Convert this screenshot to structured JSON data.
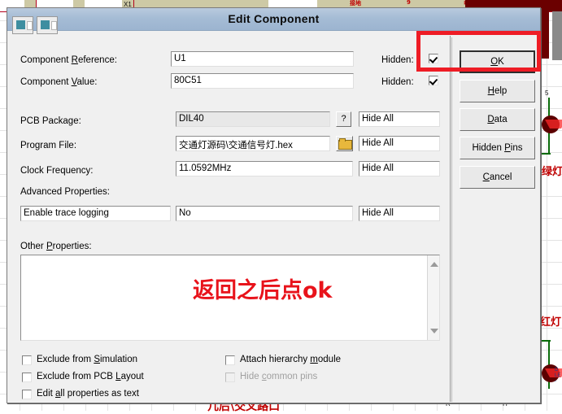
{
  "window": {
    "title": "Edit Component",
    "icons": [
      "document-icon-1",
      "document-icon-2"
    ]
  },
  "form": {
    "component_reference": {
      "label": "Component Reference:",
      "value": "U1",
      "hidden_label": "Hidden:",
      "hidden_checked": true
    },
    "component_value": {
      "label": "Component Value:",
      "value": "80C51",
      "hidden_label": "Hidden:",
      "hidden_checked": true
    },
    "pcb_package": {
      "label": "PCB Package:",
      "value": "DIL40",
      "help_button": "?",
      "visibility": "Hide All"
    },
    "program_file": {
      "label": "Program File:",
      "value": "交通灯源码\\交通信号灯.hex",
      "browse_icon": "folder-open-icon",
      "visibility": "Hide All"
    },
    "clock_frequency": {
      "label": "Clock Frequency:",
      "value": "11.0592MHz",
      "visibility": "Hide All"
    },
    "advanced_properties": {
      "label": "Advanced Properties:",
      "property": "Enable trace logging",
      "value": "No",
      "visibility": "Hide All"
    },
    "other_properties": {
      "label": "Other Properties:",
      "value": "",
      "annotation": "返回之后点ok"
    },
    "checkboxes": [
      {
        "label": "Exclude from Simulation",
        "checked": false,
        "disabled": false
      },
      {
        "label": "Exclude from PCB Layout",
        "checked": false,
        "disabled": false
      },
      {
        "label": "Edit all properties as text",
        "checked": false,
        "disabled": false
      },
      {
        "label": "Attach hierarchy module",
        "checked": false,
        "disabled": false
      },
      {
        "label": "Hide common pins",
        "checked": false,
        "disabled": true
      }
    ]
  },
  "buttons": [
    {
      "label": "OK",
      "default": true
    },
    {
      "label": "Help",
      "default": false
    },
    {
      "label": "Data",
      "default": false
    },
    {
      "label": "Hidden Pins",
      "default": false
    },
    {
      "label": "Cancel",
      "default": false
    }
  ],
  "background": {
    "schematic_labels": [
      "X1",
      "5",
      "R"
    ],
    "red_texts": [
      "绿灯",
      "红灯",
      "几后\\交叉路口"
    ]
  },
  "colors": {
    "titlebar": "#a5bcd5",
    "dialog_face": "#f0f0f0",
    "annotation_red": "#e8131b",
    "highlight_rect": "#ee1c25",
    "schematic_wire": "#0a6b0a",
    "schematic_red": "#b3001b"
  }
}
